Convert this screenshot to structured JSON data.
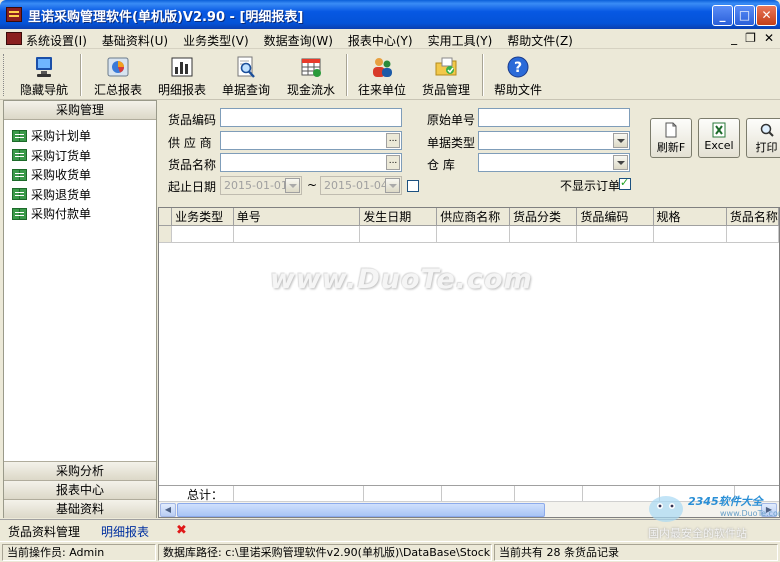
{
  "window": {
    "title": "里诺采购管理软件(单机版)V2.90 - [明细报表]"
  },
  "menu": [
    "系统设置(I)",
    "基础资料(U)",
    "业务类型(V)",
    "数据查询(W)",
    "报表中心(Y)",
    "实用工具(Y)",
    "帮助文件(Z)"
  ],
  "toolbar": {
    "hide_nav": "隐藏导航",
    "summary_report": "汇总报表",
    "detail_report": "明细报表",
    "doc_query": "单据查询",
    "cash_flow": "现金流水",
    "partners": "往来单位",
    "goods_mgmt": "货品管理",
    "help": "帮助文件"
  },
  "left_panel": {
    "header": "采购管理",
    "items": [
      "采购计划单",
      "采购订货单",
      "采购收货单",
      "采购退货单",
      "采购付款单"
    ],
    "bottom_sections": [
      "采购分析",
      "报表中心",
      "基础资料"
    ]
  },
  "form": {
    "goods_code_label": "货品编码",
    "supplier_label": "供 应 商",
    "goods_name_label": "货品名称",
    "date_range_label": "起止日期",
    "date_from": "2015-01-01",
    "date_to": "2015-01-04",
    "date_sep": "~",
    "orig_no_label": "原始单号",
    "doc_type_label": "单据类型",
    "warehouse_label": "仓    库",
    "hide_orders_label": "不显示订单",
    "ellipsis": "..."
  },
  "buttons": {
    "refresh": "刷新F",
    "excel": "Excel",
    "print": "打印"
  },
  "grid": {
    "columns": [
      "业务类型",
      "单号",
      "发生日期",
      "供应商名称",
      "货品分类",
      "货品编码",
      "规格",
      "货品名称"
    ],
    "total_label": "总计："
  },
  "watermark": "www.DuoTe.com",
  "tabs": [
    "货品资料管理",
    "明细报表"
  ],
  "status": {
    "operator": "当前操作员: Admin",
    "db_path": "数据库路径: c:\\里诺采购管理软件v2.90(单机版)\\DataBase\\Stock",
    "record_count": "当前共有 28 条货品记录"
  },
  "corner_logo": {
    "brand": "2345软件大全",
    "url": "www.DuoTe.com",
    "slogan": "国内最安全的软件站"
  }
}
